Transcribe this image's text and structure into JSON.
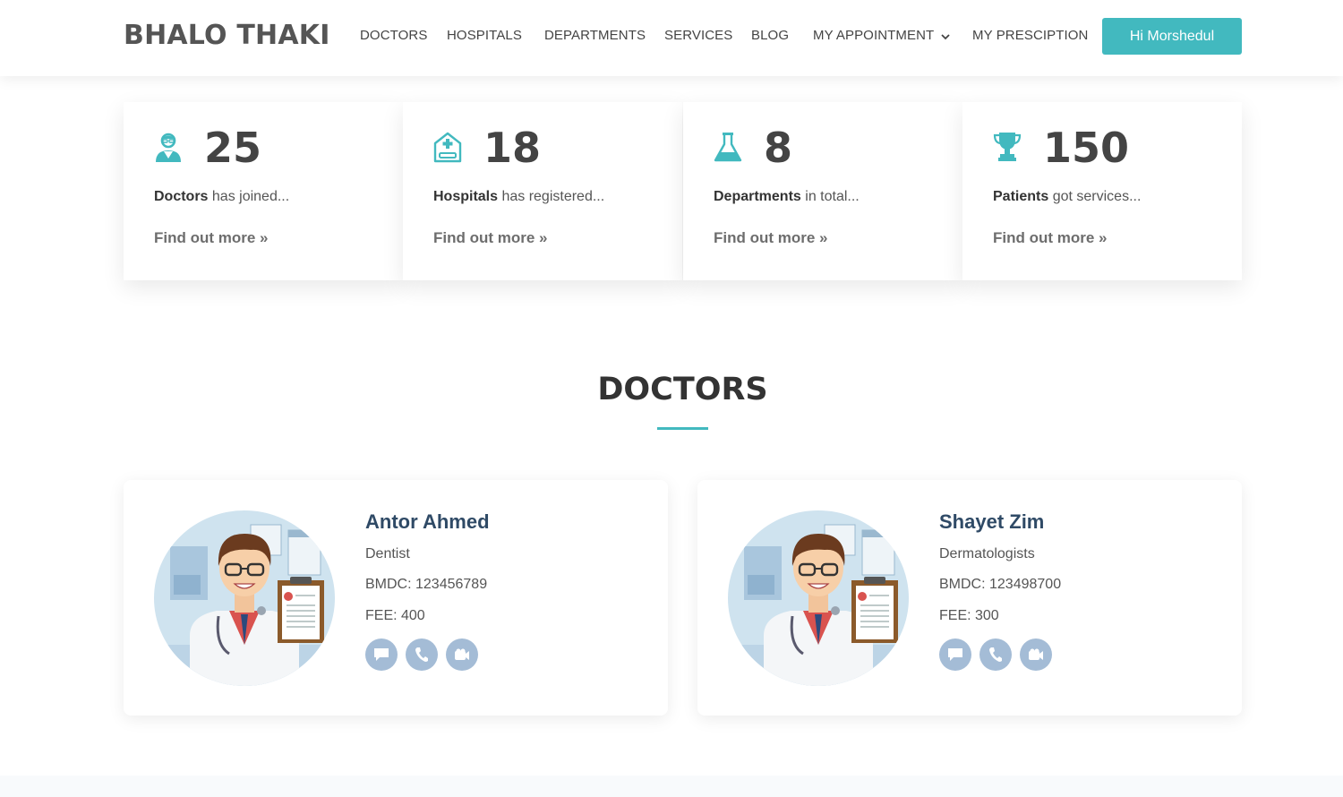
{
  "brand": "BHALO THAKI",
  "nav": {
    "doctors": "DOCTORS",
    "hospitals": "HOSPITALS",
    "departments": "DEPARTMENTS",
    "services": "SERVICES",
    "blog": "BLOG",
    "my_appointment": "MY APPOINTMENT",
    "my_prescription": "MY PRESCIPTION"
  },
  "user_button": "Hi Morshedul",
  "stats": [
    {
      "icon": "doctor-icon",
      "number": "25",
      "bold": "Doctors",
      "rest": " has joined...",
      "link": "Find out more »"
    },
    {
      "icon": "hospital-icon",
      "number": "18",
      "bold": "Hospitals",
      "rest": " has registered...",
      "link": "Find out more »"
    },
    {
      "icon": "flask-icon",
      "number": "8",
      "bold": "Departments",
      "rest": " in total...",
      "link": "Find out more »"
    },
    {
      "icon": "trophy-icon",
      "number": "150",
      "bold": "Patients",
      "rest": " got services...",
      "link": "Find out more »"
    }
  ],
  "doctors_section": {
    "title": "DOCTORS",
    "cards": [
      {
        "name": "Antor Ahmed",
        "specialty": "Dentist",
        "bmdc": "BMDC: 123456789",
        "fee": "FEE: 400"
      },
      {
        "name": "Shayet Zim",
        "specialty": "Dermatologists",
        "bmdc": "BMDC: 123498700",
        "fee": "FEE: 300"
      }
    ]
  },
  "colors": {
    "accent": "#42b9bf",
    "name": "#2f4a66",
    "action": "#a4bcd6"
  }
}
